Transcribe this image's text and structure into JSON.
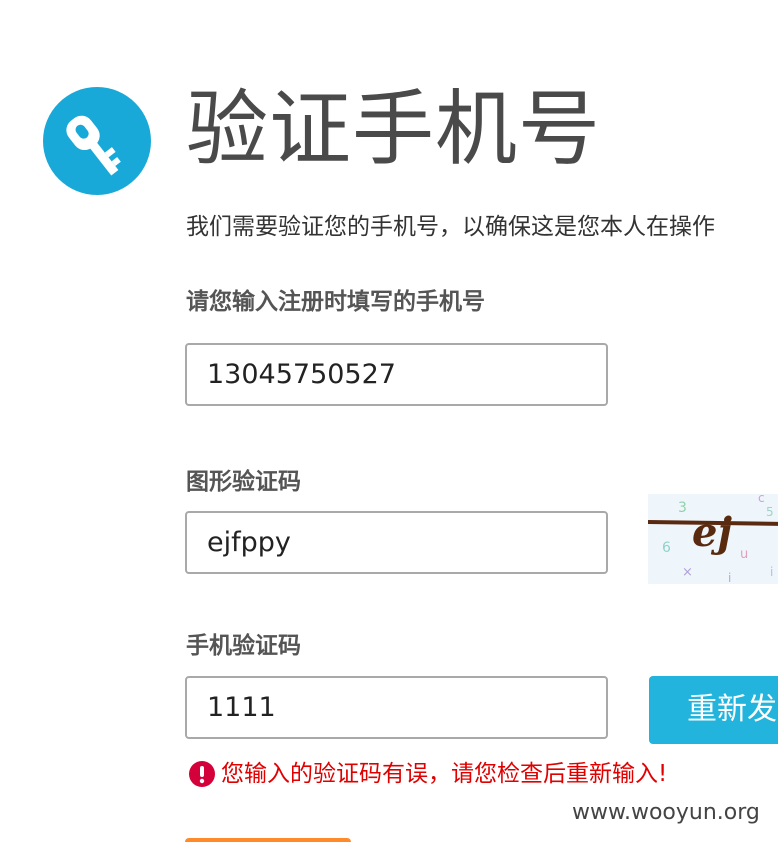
{
  "header": {
    "title": "验证手机号",
    "icon": "key-icon",
    "accent_color": "#19a9d8"
  },
  "intro_text": "我们需要验证您的手机号，以确保这是您本人在操作",
  "phone": {
    "label": "请您输入注册时填写的手机号",
    "value": "13045750527"
  },
  "image_captcha": {
    "label": "图形验证码",
    "value": "ejfppy",
    "image_text": "ej"
  },
  "sms_code": {
    "label": "手机验证码",
    "value": "1111",
    "resend_label": "重新发"
  },
  "error": {
    "icon": "exclamation-icon",
    "message": "您输入的验证码有误，请您检查后重新输入!",
    "color": "#e00000"
  },
  "watermark": "www.wooyun.org"
}
